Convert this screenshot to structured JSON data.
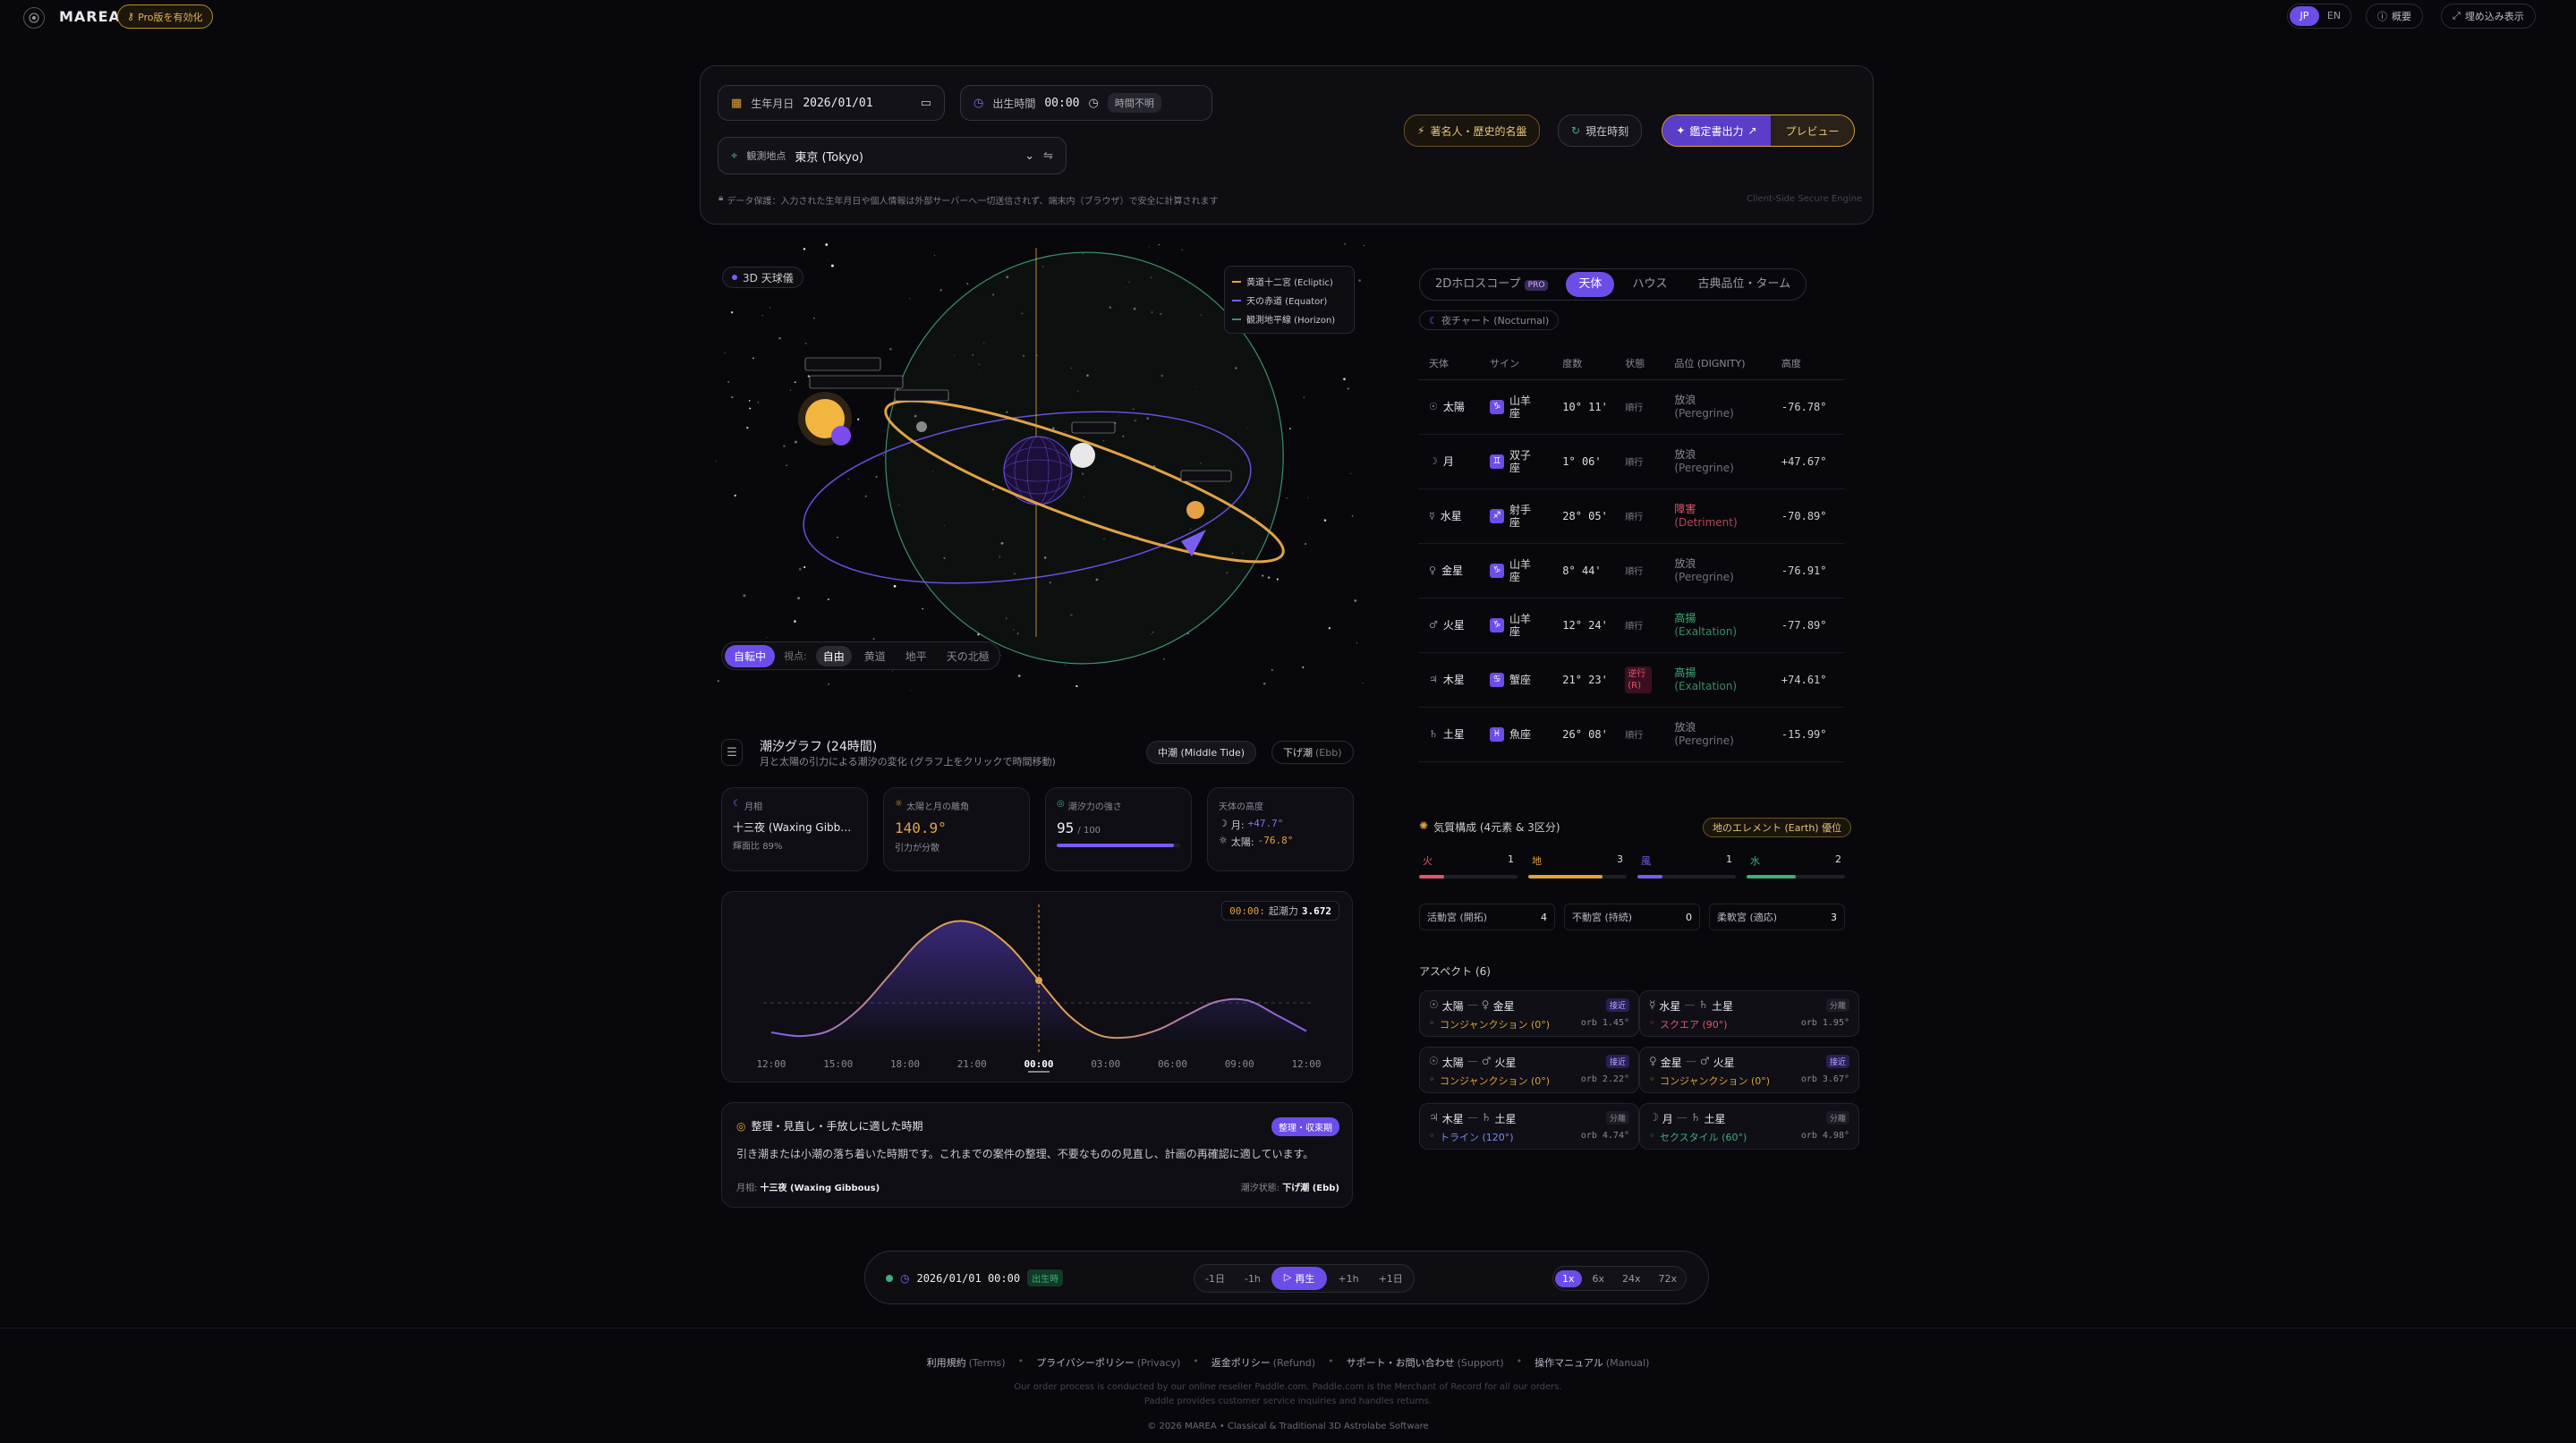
{
  "header": {
    "brand": "MAREA",
    "pro_label": "Pro版を有効化",
    "lang_jp": "JP",
    "lang_en": "EN",
    "overview": "概要",
    "embed": "埋め込み表示"
  },
  "form": {
    "birthdate_label": "生年月日",
    "birthdate_value": "2026/01/01",
    "birthtime_label": "出生時間",
    "birthtime_value": "00:00",
    "time_unknown": "時間不明",
    "location_label": "観測地点",
    "location_value": "東京 (Tokyo)",
    "famous_button": "著名人・歴史的名盤",
    "now_button": "現在時刻",
    "export_button": "鑑定書出力",
    "preview_button": "プレビュー",
    "privacy_note": "データ保護：入力された生年月日や個人情報は外部サーバーへ一切送信されず、端末内（ブラウザ）で安全に計算されます",
    "engine_note": "Client-Side Secure Engine"
  },
  "sphere": {
    "badge": "3D 天球儀",
    "legend": [
      "黄道十二宮 (Ecliptic)",
      "天の赤道 (Equator)",
      "観測地平線 (Horizon)"
    ],
    "legend_colors": [
      "#e3a246",
      "#7a5cf0",
      "#3c8f6a"
    ],
    "rotate_label": "自転中",
    "view_label": "視点:",
    "views": [
      "自由",
      "黄道",
      "地平",
      "天の北極"
    ],
    "active_view": "自由"
  },
  "tide": {
    "title": "潮汐グラフ (24時間)",
    "subtitle": "月と太陽の引力による潮汐の変化 (グラフ上をクリックで時間移動)",
    "tag_middle": "中潮 (Middle Tide)",
    "tag_ebb_label": "下げ潮",
    "tag_ebb_sub": "(Ebb)",
    "moon_phase_label": "月相",
    "moon_phase_value": "十三夜 (Waxing Gibb…",
    "illum_label": "輝面比",
    "illum_value": "89%",
    "sunmoon_label": "太陽と月の離角",
    "sunmoon_value": "140.9°",
    "sunmoon_sub": "引力が分散",
    "strength_label": "潮汐力の強さ",
    "strength_value": "95",
    "strength_max": "/ 100",
    "strength_fraction": 0.95,
    "altitude_label": "天体の高度",
    "moon_alt_label": "月:",
    "moon_alt_value": "+47.7°",
    "sun_alt_label": "太陽:",
    "sun_alt_value": "-76.8°",
    "current_time": "00:00:",
    "current_label": "起潮力",
    "current_value": "3.672"
  },
  "chart_data": {
    "type": "area",
    "x": [
      "12:00",
      "15:00",
      "18:00",
      "21:00",
      "00:00",
      "03:00",
      "06:00",
      "09:00",
      "12:00"
    ],
    "highlight_x": "00:00",
    "curve": [
      {
        "t": 0,
        "v": 0.08
      },
      {
        "t": 1,
        "v": 0.05
      },
      {
        "t": 2,
        "v": 0.1
      },
      {
        "t": 3,
        "v": 0.28
      },
      {
        "t": 4,
        "v": 0.55
      },
      {
        "t": 5,
        "v": 0.82
      },
      {
        "t": 6,
        "v": 0.97
      },
      {
        "t": 7,
        "v": 0.95
      },
      {
        "t": 8,
        "v": 0.78
      },
      {
        "t": 9,
        "v": 0.5
      },
      {
        "t": 10,
        "v": 0.22
      },
      {
        "t": 11,
        "v": 0.06
      },
      {
        "t": 12,
        "v": 0.04
      },
      {
        "t": 13,
        "v": 0.1
      },
      {
        "t": 14,
        "v": 0.22
      },
      {
        "t": 15,
        "v": 0.33
      },
      {
        "t": 16,
        "v": 0.34
      },
      {
        "t": 17,
        "v": 0.22
      },
      {
        "t": 18,
        "v": 0.09
      }
    ],
    "xlabel": "",
    "ylabel": ""
  },
  "advice": {
    "title": "整理・見直し・手放しに適した時期",
    "badge": "整理・収束期",
    "body": "引き潮または小潮の落ち着いた時期です。これまでの案件の整理、不要なものの見直し、計画の再確認に適しています。",
    "moon_label": "月相:",
    "moon_value": "十三夜 (Waxing Gibbous)",
    "state_label": "潮汐状態:",
    "state_value": "下げ潮 (Ebb)"
  },
  "playbar": {
    "datetime": "2026/01/01 00:00",
    "birth_tag": "出生時",
    "minus_day": "-1日",
    "minus_hour": "-1h",
    "play": "再生",
    "plus_hour": "+1h",
    "plus_day": "+1日",
    "speeds": [
      "1x",
      "6x",
      "24x",
      "72x"
    ]
  },
  "right": {
    "tabs": [
      "2Dホロスコープ",
      "天体",
      "ハウス",
      "古典品位・ターム"
    ],
    "pro_tag": "PRO",
    "night_chart": "夜チャート (Nocturnal)",
    "columns": [
      "天体",
      "サイン",
      "度数",
      "状態",
      "品位 (DIGNITY)",
      "高度"
    ],
    "rows": [
      {
        "glyph": "☉",
        "name": "太陽",
        "sign_glyph": "♑",
        "sign": "山羊座",
        "deg": "10° 11'",
        "state": "順行",
        "dignity": "放浪",
        "dignity_en": "(Peregrine)",
        "dcolor": "#8a8a96",
        "alt": "-76.78°"
      },
      {
        "glyph": "☽",
        "name": "月",
        "sign_glyph": "♊",
        "sign": "双子座",
        "deg": "1° 06'",
        "state": "順行",
        "dignity": "放浪",
        "dignity_en": "(Peregrine)",
        "dcolor": "#8a8a96",
        "alt": "+47.67°"
      },
      {
        "glyph": "☿",
        "name": "水星",
        "sign_glyph": "♐",
        "sign": "射手座",
        "deg": "28° 05'",
        "state": "順行",
        "dignity": "障害",
        "dignity_en": "(Detriment)",
        "dcolor": "#e0566a",
        "alt": "-70.89°"
      },
      {
        "glyph": "♀",
        "name": "金星",
        "sign_glyph": "♑",
        "sign": "山羊座",
        "deg": "8° 44'",
        "state": "順行",
        "dignity": "放浪",
        "dignity_en": "(Peregrine)",
        "dcolor": "#8a8a96",
        "alt": "-76.91°"
      },
      {
        "glyph": "♂",
        "name": "火星",
        "sign_glyph": "♑",
        "sign": "山羊座",
        "deg": "12° 24'",
        "state": "順行",
        "dignity": "高揚",
        "dignity_en": "(Exaltation)",
        "dcolor": "#3fae7a",
        "alt": "-77.89°"
      },
      {
        "glyph": "♃",
        "name": "木星",
        "sign_glyph": "♋",
        "sign": "蟹座",
        "deg": "21° 23'",
        "state": "逆行 (R)",
        "dignity": "高揚",
        "dignity_en": "(Exaltation)",
        "dcolor": "#3fae7a",
        "alt": "+74.61°"
      },
      {
        "glyph": "♄",
        "name": "土星",
        "sign_glyph": "♓",
        "sign": "魚座",
        "deg": "26° 08'",
        "state": "順行",
        "dignity": "放浪",
        "dignity_en": "(Peregrine)",
        "dcolor": "#8a8a96",
        "alt": "-15.99°"
      }
    ]
  },
  "elements": {
    "title": "気質構成 (4元素 & 3区分)",
    "badge": "地のエレメント (Earth) 優位",
    "items": [
      {
        "name": "火",
        "count": "1",
        "fraction": 0.25,
        "color": "#e0566a"
      },
      {
        "name": "地",
        "count": "3",
        "fraction": 0.75,
        "color": "#e0a23a"
      },
      {
        "name": "風",
        "count": "1",
        "fraction": 0.25,
        "color": "#7a5cf0"
      },
      {
        "name": "水",
        "count": "2",
        "fraction": 0.5,
        "color": "#3fae7a"
      }
    ],
    "modes": [
      {
        "name": "活動宮 (開拓)",
        "count": "4"
      },
      {
        "name": "不動宮 (持続)",
        "count": "0"
      },
      {
        "name": "柔軟宮 (適応)",
        "count": "3"
      }
    ]
  },
  "aspects": {
    "title": "アスペクト (6)",
    "items": [
      {
        "p1": "太陽",
        "g1": "☉",
        "p2": "金星",
        "g2": "♀",
        "tag": "接近",
        "aspect": "コンジャンクション (0°)",
        "orb": "orb 1.45°",
        "acolor": "#e0a23a"
      },
      {
        "p1": "水星",
        "g1": "☿",
        "p2": "土星",
        "g2": "♄",
        "tag": "分離",
        "aspect": "スクエア (90°)",
        "orb": "orb 1.95°",
        "acolor": "#e0566a"
      },
      {
        "p1": "太陽",
        "g1": "☉",
        "p2": "火星",
        "g2": "♂",
        "tag": "接近",
        "aspect": "コンジャンクション (0°)",
        "orb": "orb 2.22°",
        "acolor": "#e0a23a"
      },
      {
        "p1": "金星",
        "g1": "♀",
        "p2": "火星",
        "g2": "♂",
        "tag": "接近",
        "aspect": "コンジャンクション (0°)",
        "orb": "orb 3.67°",
        "acolor": "#e0a23a"
      },
      {
        "p1": "木星",
        "g1": "♃",
        "p2": "土星",
        "g2": "♄",
        "tag": "分離",
        "aspect": "トライン (120°)",
        "orb": "orb 4.74°",
        "acolor": "#7a8af0"
      },
      {
        "p1": "月",
        "g1": "☽",
        "p2": "土星",
        "g2": "♄",
        "tag": "分離",
        "aspect": "セクスタイル (60°)",
        "orb": "orb 4.98°",
        "acolor": "#3fae7a"
      }
    ]
  },
  "footer": {
    "links": [
      {
        "label": "利用規約",
        "sub": "(Terms)"
      },
      {
        "label": "プライバシーポリシー",
        "sub": "(Privacy)"
      },
      {
        "label": "返金ポリシー",
        "sub": "(Refund)"
      },
      {
        "label": "サポート・お問い合わせ",
        "sub": "(Support)"
      },
      {
        "label": "操作マニュアル",
        "sub": "(Manual)"
      }
    ],
    "note1": "Our order process is conducted by our online reseller Paddle.com. Paddle.com is the Merchant of Record for all our orders.",
    "note2": "Paddle provides customer service inquiries and handles returns.",
    "copyright": "© 2026 MAREA • Classical & Traditional 3D Astrolabe Software"
  }
}
